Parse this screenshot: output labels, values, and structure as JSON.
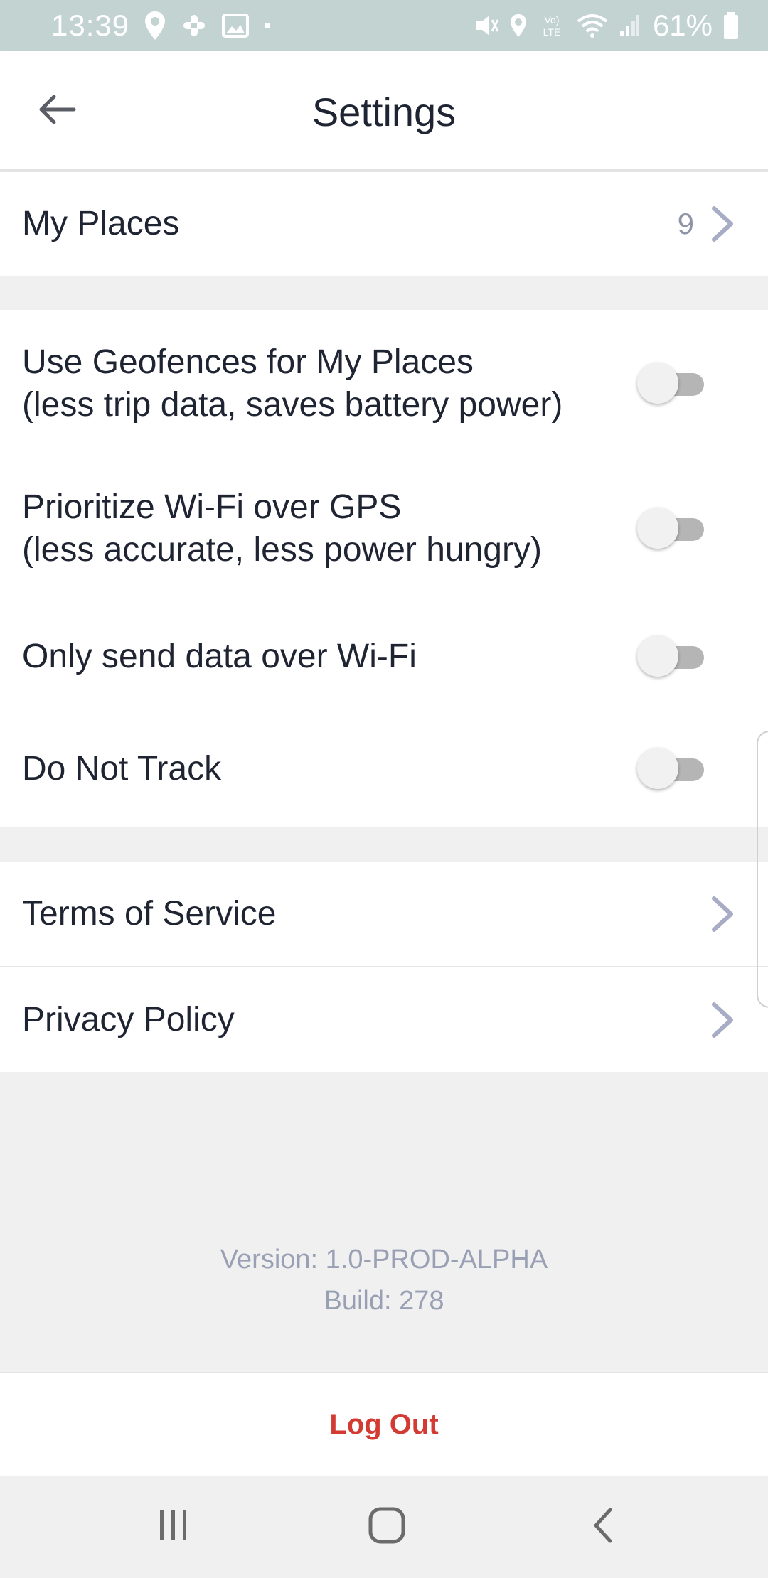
{
  "status_bar": {
    "time": "13:39",
    "battery": "61%",
    "network_label": "Vo) LTE"
  },
  "header": {
    "title": "Settings",
    "back_icon": "arrow-left-icon"
  },
  "places": {
    "label": "My Places",
    "count": "9"
  },
  "toggles": [
    {
      "id": "geofences",
      "line1": "Use Geofences for My Places",
      "line2": "(less trip data, saves battery power)",
      "on": false
    },
    {
      "id": "wifi-over-gps",
      "line1": "Prioritize Wi-Fi over GPS",
      "line2": "(less accurate, less power hungry)",
      "on": false
    },
    {
      "id": "wifi-only",
      "line1": "Only send data over Wi-Fi",
      "on": false
    },
    {
      "id": "do-not-track",
      "line1": "Do Not Track",
      "on": false
    }
  ],
  "links": [
    {
      "label": "Terms of Service"
    },
    {
      "label": "Privacy Policy"
    }
  ],
  "version": {
    "version_text": "Version: 1.0-PROD-ALPHA",
    "build_text": "Build: 278"
  },
  "logout": {
    "label": "Log Out"
  },
  "nav": {
    "recents_icon": "recents-icon",
    "home_icon": "home-icon",
    "back_icon": "back-icon"
  },
  "colors": {
    "status_bar": "#c2d3d2",
    "background": "#f0f0f0",
    "text": "#1f2433",
    "muted": "#9aa0b4",
    "danger": "#d23a32",
    "chevron": "#a8acc4",
    "toggle_track": "#b5b5b5"
  }
}
